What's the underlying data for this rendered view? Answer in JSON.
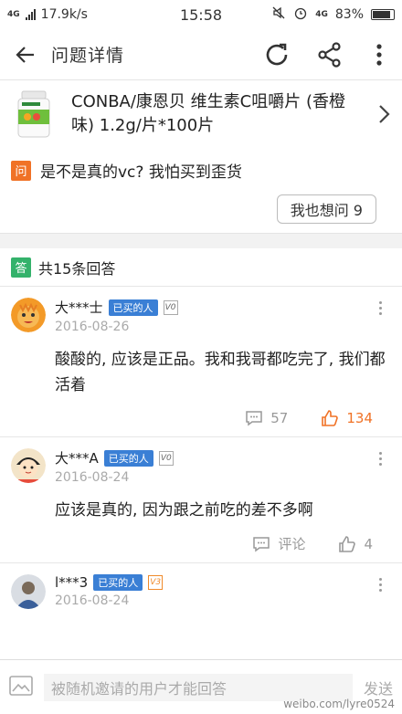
{
  "status_bar": {
    "left_network": "4G",
    "speed": "17.9k/s",
    "time": "15:58",
    "right_network": "4G",
    "battery": "83%"
  },
  "header": {
    "title": "问题详情",
    "back_icon": "back-arrow-icon",
    "refresh_icon": "refresh-icon",
    "share_icon": "share-icon",
    "menu_icon": "more-vertical-icon"
  },
  "product": {
    "name": "CONBA/康恩贝 维生素C咀嚼片 (香橙味) 1.2g/片*100片",
    "image_icon": "vitamin-bottle-image"
  },
  "question": {
    "badge": "问",
    "text": "是不是真的vc? 我怕买到歪货",
    "ask_button": "我也想问 9"
  },
  "answers_header": {
    "badge": "答",
    "count_label": "共15条回答"
  },
  "answers": [
    {
      "user": "大***士",
      "badge": "已买的人",
      "level": "V0",
      "date": "2016-08-26",
      "content": "酸酸的, 应该是正品。我和我哥都吃完了, 我们都活着",
      "comments": "57",
      "likes": "134",
      "liked": true
    },
    {
      "user": "大***A",
      "badge": "已买的人",
      "level": "V0",
      "date": "2016-08-24",
      "content": "应该是真的, 因为跟之前吃的差不多啊",
      "comments": "评论",
      "likes": "4",
      "liked": false
    },
    {
      "user": "l***3",
      "badge": "已买的人",
      "level": "V3",
      "date": "2016-08-24"
    }
  ],
  "footer": {
    "placeholder": "被随机邀请的用户才能回答",
    "send": "发送",
    "watermark": "weibo.com/lyre0524"
  },
  "colors": {
    "accent_orange": "#f07226",
    "answer_green": "#34b26b",
    "badge_blue": "#3a7fd5"
  }
}
